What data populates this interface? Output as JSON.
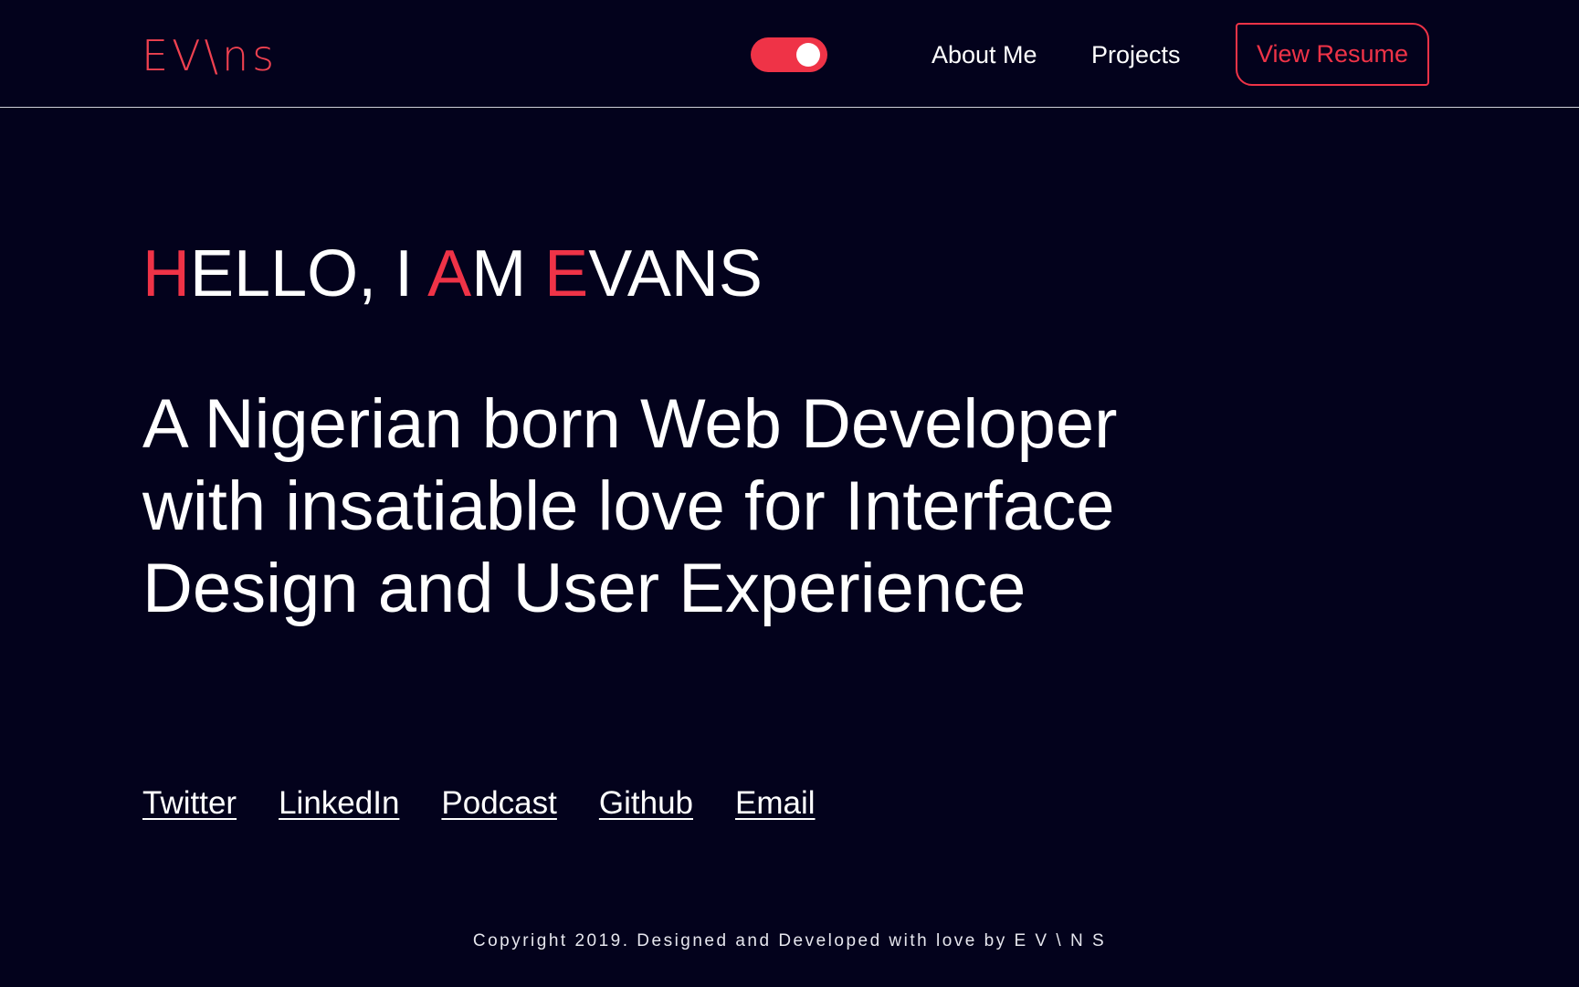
{
  "header": {
    "logo_text": "EV\\ns",
    "toggle_state": "on",
    "nav": [
      {
        "label": "About Me"
      },
      {
        "label": "Projects"
      }
    ],
    "resume_label": "View Resume"
  },
  "hero": {
    "greeting": {
      "h": "H",
      "ello": "ELLO, I ",
      "a": "A",
      "m": "M ",
      "e": "E",
      "vans": "VANS"
    },
    "tagline": "A Nigerian born Web Developer with insatiable love for Interface Design and User Experience"
  },
  "socials": [
    {
      "label": "Twitter"
    },
    {
      "label": "LinkedIn"
    },
    {
      "label": "Podcast"
    },
    {
      "label": "Github"
    },
    {
      "label": "Email"
    }
  ],
  "footer": {
    "text": "Copyright 2019. Designed and Developed with love by E V \\ N S"
  },
  "colors": {
    "background": "#03021c",
    "accent": "#ef3347",
    "text": "#ffffff"
  }
}
